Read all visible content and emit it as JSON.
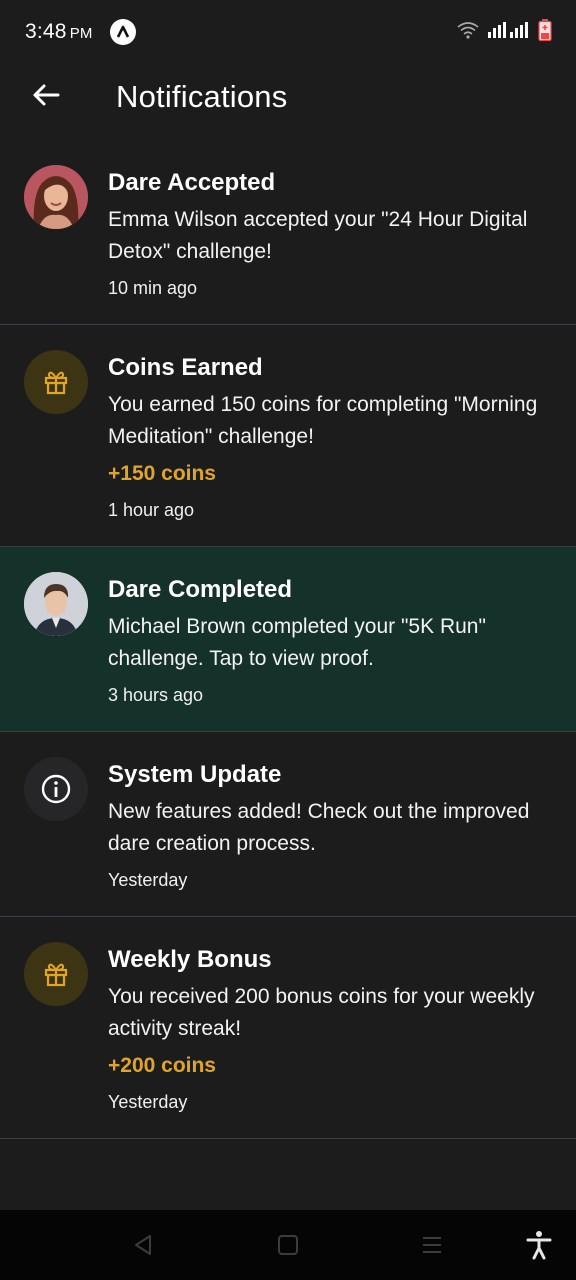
{
  "status_bar": {
    "time": "3:48",
    "ampm": "PM",
    "app_icon": "arrow-logo-icon",
    "wifi_icon": "wifi-icon",
    "signal_icon": "signal-bars-icon",
    "battery_icon": "battery-icon"
  },
  "header": {
    "back_icon": "arrow-left-icon",
    "title": "Notifications"
  },
  "notifications": [
    {
      "title": "Dare Accepted",
      "message": "Emma Wilson accepted your \"24 Hour Digital Detox\" challenge!",
      "coins": "",
      "time": "10 min ago",
      "icon": "avatar-emma-wilson"
    },
    {
      "title": "Coins Earned",
      "message": "You earned 150 coins for completing \"Morning Meditation\" challenge!",
      "coins": "+150 coins",
      "time": "1 hour ago",
      "icon": "gift-icon"
    },
    {
      "title": "Dare Completed",
      "message": "Michael Brown completed your \"5K Run\" challenge. Tap to view proof.",
      "coins": "",
      "time": "3 hours ago",
      "icon": "avatar-michael-brown"
    },
    {
      "title": "System Update",
      "message": "New features added! Check out the improved dare creation process.",
      "coins": "",
      "time": "Yesterday",
      "icon": "info-icon"
    },
    {
      "title": "Weekly Bonus",
      "message": "You received 200 bonus coins for your weekly activity streak!",
      "coins": "+200 coins",
      "time": "Yesterday",
      "icon": "gift-icon"
    }
  ],
  "nav_bar": {
    "back": "nav-back-icon",
    "home": "nav-home-icon",
    "menu": "nav-menu-icon",
    "accessibility": "accessibility-icon"
  },
  "colors": {
    "background": "#1c1c1d",
    "highlight": "#14312a",
    "accent_gold": "#e0a526",
    "divider": "#3a3f45"
  }
}
